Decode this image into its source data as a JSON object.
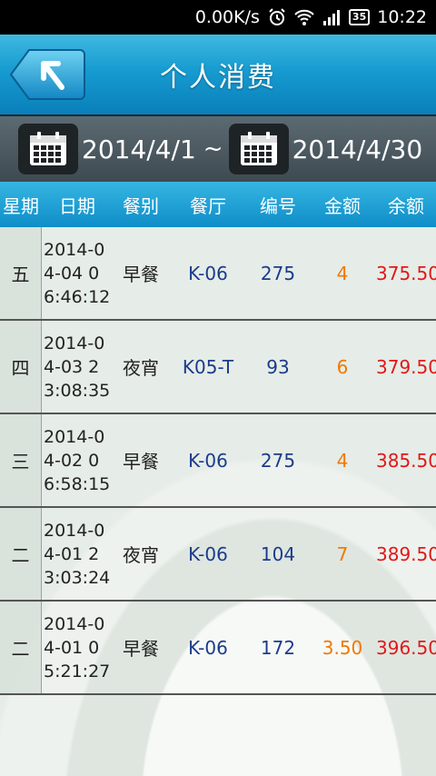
{
  "status_bar": {
    "speed": "0.00K/s",
    "battery": "35",
    "time": "10:22"
  },
  "header": {
    "title": "个人消费",
    "back_icon": "back-arrow-icon"
  },
  "date_range": {
    "start": "2014/4/1",
    "separator": "~",
    "end": "2014/4/30"
  },
  "columns": [
    "星期",
    "日期",
    "餐别",
    "餐厅",
    "编号",
    "金额",
    "余额"
  ],
  "rows": [
    {
      "weekday": "五",
      "date": "2014-04-04 06:46:12",
      "meal": "早餐",
      "restaurant": "K-06",
      "number": "275",
      "amount": "4",
      "balance": "375.50"
    },
    {
      "weekday": "四",
      "date": "2014-04-03 23:08:35",
      "meal": "夜宵",
      "restaurant": "K05-T",
      "number": "93",
      "amount": "6",
      "balance": "379.50"
    },
    {
      "weekday": "三",
      "date": "2014-04-02 06:58:15",
      "meal": "早餐",
      "restaurant": "K-06",
      "number": "275",
      "amount": "4",
      "balance": "385.50"
    },
    {
      "weekday": "二",
      "date": "2014-04-01 23:03:24",
      "meal": "夜宵",
      "restaurant": "K-06",
      "number": "104",
      "amount": "7",
      "balance": "389.50"
    },
    {
      "weekday": "二",
      "date": "2014-04-01 05:21:27",
      "meal": "早餐",
      "restaurant": "K-06",
      "number": "172",
      "amount": "3.50",
      "balance": "396.50"
    }
  ]
}
